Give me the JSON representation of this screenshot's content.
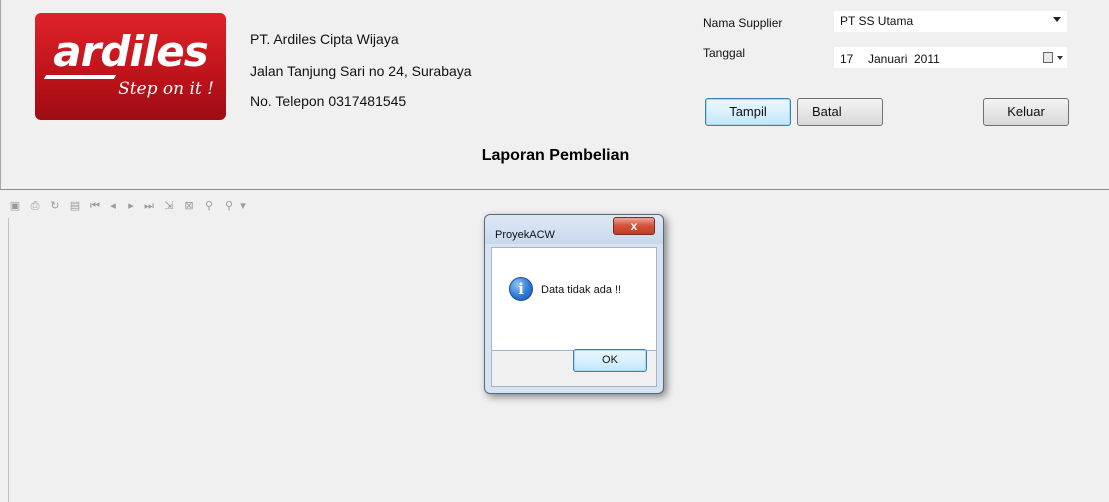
{
  "header": {
    "logo": {
      "brand": "ardiles",
      "tagline": "Step on it !",
      "color": "#d01c22"
    },
    "company": {
      "name": "PT. Ardiles Cipta Wijaya",
      "address": "Jalan Tanjung Sari no 24, Surabaya",
      "phone": "No. Telepon 0317481545"
    }
  },
  "form": {
    "supplier_label": "Nama Supplier",
    "supplier_value": "PT SS Utama",
    "tanggal_label": "Tanggal",
    "date_day": "17",
    "date_month": "Januari",
    "date_year": "2011"
  },
  "buttons": {
    "tampil": "Tampil",
    "batal": "Batal",
    "keluar": "Keluar"
  },
  "report_title": "Laporan Pembelian",
  "toolbar": {
    "icons": [
      "export-icon",
      "print-icon",
      "refresh-icon",
      "group-tree-icon",
      "first-page-icon",
      "prev-page-icon",
      "next-page-icon",
      "last-page-icon",
      "goto-page-icon",
      "stop-icon",
      "search-icon",
      "zoom-icon"
    ]
  },
  "dialog": {
    "title": "ProyekACW",
    "close_glyph": "x",
    "message": "Data tidak ada !!",
    "ok_label": "OK",
    "icon": "info-icon"
  }
}
